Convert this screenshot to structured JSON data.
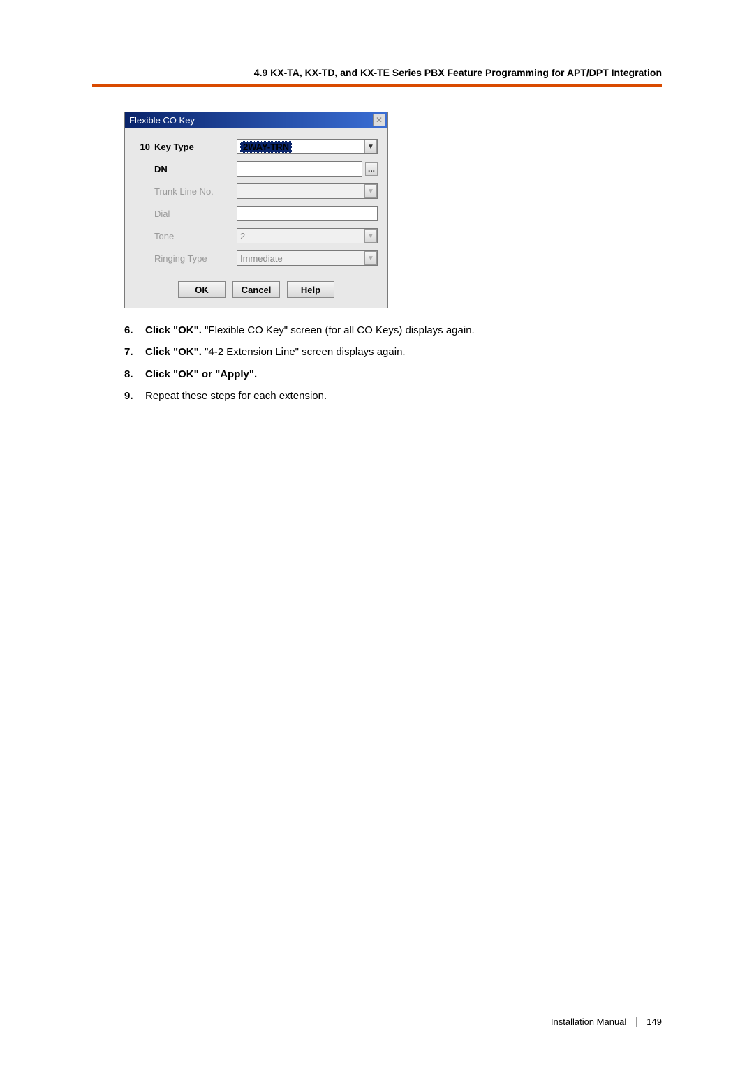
{
  "header": {
    "title": "4.9 KX-TA, KX-TD, and KX-TE Series PBX Feature Programming for APT/DPT Integration"
  },
  "dialog": {
    "title": "Flexible CO Key",
    "close_icon": "✕",
    "row_num": "10",
    "fields": {
      "key_type": {
        "label": "Key Type",
        "value": "2WAY-TRN"
      },
      "dn": {
        "label": "DN",
        "value": ""
      },
      "trunk": {
        "label": "Trunk Line No.",
        "value": ""
      },
      "dial": {
        "label": "Dial",
        "value": ""
      },
      "tone": {
        "label": "Tone",
        "value": "2"
      },
      "ringing": {
        "label": "Ringing Type",
        "value": "Immediate"
      }
    },
    "more_label": "...",
    "buttons": {
      "ok": {
        "ul": "O",
        "rest": "K"
      },
      "cancel": {
        "ul": "C",
        "rest": "ancel"
      },
      "help": {
        "ul": "H",
        "rest": "elp"
      }
    }
  },
  "steps": [
    {
      "n": "6.",
      "bold": "Click \"OK\".",
      "rest": " \"Flexible CO Key\" screen (for all CO Keys) displays again."
    },
    {
      "n": "7.",
      "bold": "Click \"OK\".",
      "rest": " \"4-2 Extension Line\" screen displays again."
    },
    {
      "n": "8.",
      "bold": "Click \"OK\"",
      "rest_bold": " or \"Apply\"."
    },
    {
      "n": "9.",
      "bold": "",
      "rest": "Repeat these steps for each extension."
    }
  ],
  "footer": {
    "doc": "Installation Manual",
    "page": "149"
  }
}
